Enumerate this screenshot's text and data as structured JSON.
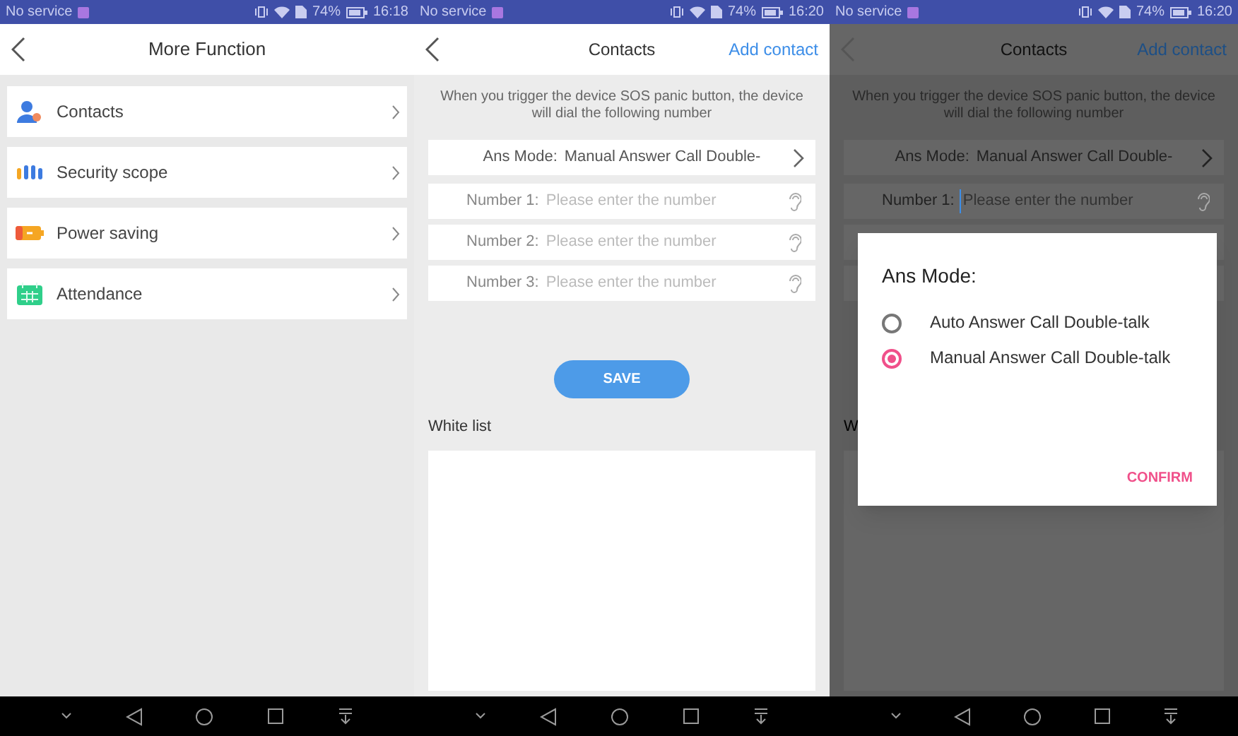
{
  "screens": [
    {
      "kind": "menu",
      "status_bar": {
        "carrier": "No service",
        "battery": "74%",
        "time": "16:18"
      },
      "header": {
        "title": "More Function"
      },
      "items": [
        {
          "label": "Contacts",
          "kind": "contacts"
        },
        {
          "label": "Security scope",
          "kind": "security"
        },
        {
          "label": "Power saving",
          "kind": "power"
        },
        {
          "label": "Attendance",
          "kind": "attendance"
        }
      ]
    },
    {
      "kind": "contacts",
      "status_bar": {
        "carrier": "No service",
        "battery": "74%",
        "time": "16:20"
      },
      "header": {
        "title": "Contacts",
        "action": "Add contact"
      },
      "description": "When you trigger the device SOS panic button, the device will dial the following number",
      "ans_mode": {
        "label": "Ans Mode:",
        "value": "Manual Answer Call Double-"
      },
      "numbers": [
        {
          "label": "Number 1:",
          "placeholder": "Please enter the number",
          "focused": false
        },
        {
          "label": "Number 2:",
          "placeholder": "Please enter the number",
          "focused": false
        },
        {
          "label": "Number 3:",
          "placeholder": "Please enter the number",
          "focused": false
        }
      ],
      "save_button": "SAVE",
      "white_list": {
        "title": "White list"
      }
    },
    {
      "kind": "contacts",
      "status_bar": {
        "carrier": "No service",
        "battery": "74%",
        "time": "16:20"
      },
      "header": {
        "title": "Contacts",
        "action": "Add contact"
      },
      "description": "When you trigger the device SOS panic button, the device will dial the following number",
      "ans_mode": {
        "label": "Ans Mode:",
        "value": "Manual Answer Call Double-"
      },
      "numbers": [
        {
          "label": "Number 1:",
          "placeholder": "Please enter the number",
          "focused": true
        }
      ],
      "white_list": {
        "title": "W"
      },
      "dialog": {
        "title": "Ans Mode:",
        "options": [
          {
            "label": "Auto Answer Call Double-talk",
            "selected": false
          },
          {
            "label": "Manual Answer Call Double-talk",
            "selected": true
          }
        ],
        "confirm": "CONFIRM"
      }
    }
  ]
}
